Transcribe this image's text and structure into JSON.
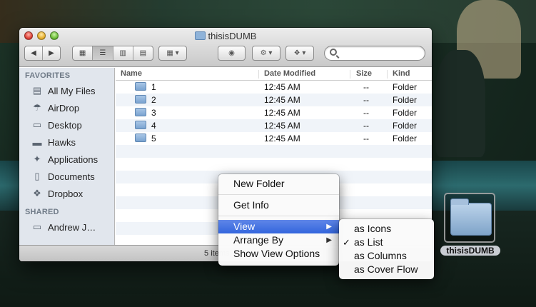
{
  "window": {
    "title": "thisisDUMB",
    "status": "5 items, 803"
  },
  "sidebar": {
    "favorites_header": "FAVORITES",
    "shared_header": "SHARED",
    "items": [
      {
        "label": "All My Files",
        "icon": "all-files-icon"
      },
      {
        "label": "AirDrop",
        "icon": "airdrop-icon"
      },
      {
        "label": "Desktop",
        "icon": "desktop-icon"
      },
      {
        "label": "Hawks",
        "icon": "drive-icon"
      },
      {
        "label": "Applications",
        "icon": "applications-icon"
      },
      {
        "label": "Documents",
        "icon": "documents-icon"
      },
      {
        "label": "Dropbox",
        "icon": "dropbox-icon"
      }
    ],
    "shared": [
      {
        "label": "Andrew  J…",
        "icon": "computer-icon"
      }
    ]
  },
  "columns": {
    "name": "Name",
    "date": "Date Modified",
    "size": "Size",
    "kind": "Kind"
  },
  "files": [
    {
      "name": "1",
      "date": "12:45 AM",
      "size": "--",
      "kind": "Folder"
    },
    {
      "name": "2",
      "date": "12:45 AM",
      "size": "--",
      "kind": "Folder"
    },
    {
      "name": "3",
      "date": "12:45 AM",
      "size": "--",
      "kind": "Folder"
    },
    {
      "name": "4",
      "date": "12:45 AM",
      "size": "--",
      "kind": "Folder"
    },
    {
      "name": "5",
      "date": "12:45 AM",
      "size": "--",
      "kind": "Folder"
    }
  ],
  "context_menu": {
    "new_folder": "New Folder",
    "get_info": "Get Info",
    "view": "View",
    "arrange_by": "Arrange By",
    "show_view_options": "Show View Options"
  },
  "view_submenu": {
    "as_icons": "as Icons",
    "as_list": "as List",
    "as_columns": "as Columns",
    "as_cover_flow": "as Cover Flow",
    "checked": "as List"
  },
  "desktop_icon": {
    "label": "thisisDUMB"
  },
  "colors": {
    "selection": "#3366dd",
    "sidebar_bg": "#e1e6ed"
  }
}
